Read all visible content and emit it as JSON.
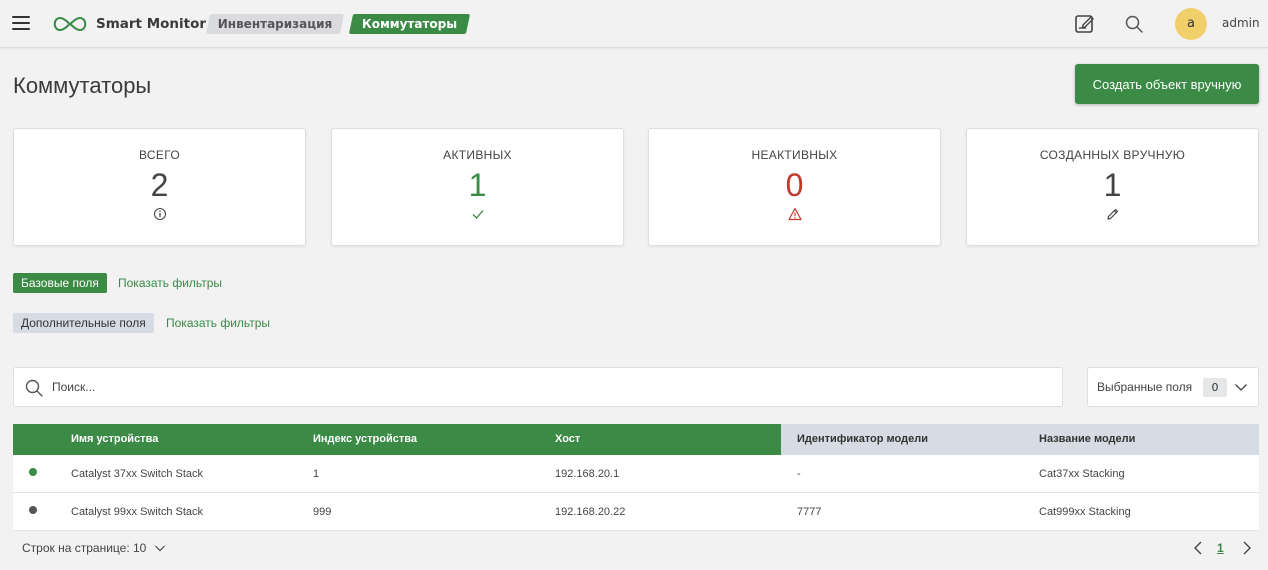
{
  "app": {
    "name": "Smart Monitor"
  },
  "breadcrumbs": [
    {
      "label": "Инвентаризация"
    },
    {
      "label": "Коммутаторы"
    }
  ],
  "user": {
    "avatar_letter": "a",
    "name": "admin"
  },
  "page": {
    "title": "Коммутаторы",
    "create_button": "Создать объект вручную"
  },
  "stats": [
    {
      "label": "ВСЕГО",
      "value": "2",
      "icon": "info-icon",
      "color": "#444444"
    },
    {
      "label": "АКТИВНЫХ",
      "value": "1",
      "icon": "check-icon",
      "color": "#3b8a45"
    },
    {
      "label": "НЕАКТИВНЫХ",
      "value": "0",
      "icon": "warning-icon",
      "color": "#c0392b"
    },
    {
      "label": "СОЗДАННЫХ ВРУЧНУЮ",
      "value": "1",
      "icon": "pencil-icon",
      "color": "#444444"
    }
  ],
  "filters": {
    "base": {
      "label": "Базовые поля",
      "link": "Показать фильтры"
    },
    "extra": {
      "label": "Дополнительные поля",
      "link": "Показать фильтры"
    }
  },
  "search": {
    "placeholder": "Поиск..."
  },
  "selected_fields": {
    "label": "Выбранные поля",
    "count": "0"
  },
  "table": {
    "columns": [
      "Имя устройства",
      "Индекс устройства",
      "Хост",
      "Идентификатор модели",
      "Название модели"
    ],
    "rows": [
      {
        "status_color": "#3b8a45",
        "name": "Catalyst 37xx Switch Stack",
        "index": "1",
        "host": "192.168.20.1",
        "model_id": "-",
        "model_name": "Cat37xx Stacking"
      },
      {
        "status_color": "#555555",
        "name": "Catalyst 99xx Switch Stack",
        "index": "999",
        "host": "192.168.20.22",
        "model_id": "7777",
        "model_name": "Cat999xx Stacking"
      }
    ]
  },
  "pagination": {
    "rows_per_page_label": "Строк на странице: 10",
    "current_page": "1"
  },
  "colors": {
    "accent": "#3b8a45",
    "danger": "#c0392b",
    "avatar": "#f1cf6b"
  }
}
